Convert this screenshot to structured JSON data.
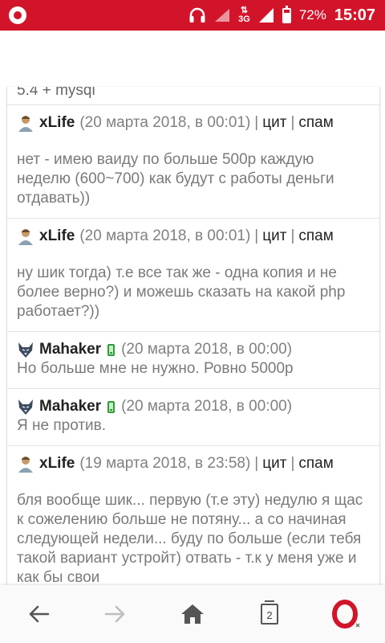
{
  "status_bar": {
    "network": "3G",
    "battery_percent": "72%",
    "battery_level": 0.72,
    "time": "15:07"
  },
  "truncated_line": "5.4 + mysql",
  "posts": [
    {
      "author": "xLife",
      "date": "(20 марта 2018, в 00:01)",
      "cite": "цит",
      "spam": "спам",
      "text": "нет - имею ваиду по больше 500р каждую неделю (600~700) как будут с работы деньги отдавать))"
    },
    {
      "author": "xLife",
      "date": "(20 марта 2018, в 00:01)",
      "cite": "цит",
      "spam": "спам",
      "text": "ну шик тогда) т.е все так же - одна копия и не более верно?) и можешь сказать на какой php работает?))"
    },
    {
      "author": "Mahaker",
      "date": "(20 марта 2018, в 00:00)",
      "text": "Но больше мне не нужно. Ровно 5000р"
    },
    {
      "author": "Mahaker",
      "date": "(20 марта 2018, в 00:00)",
      "text": "Я не против."
    },
    {
      "author": "xLife",
      "date": "(19 марта 2018, в 23:58)",
      "cite": "цит",
      "spam": "спам",
      "text": "бля вообще шик... первую (т.е эту) недулю я щас к сожелению больше не потяну... а со начиная следующей недели... буду по больше (если тебя такой вариант устройт) отвать - т.к у меня уже и как бы свои"
    }
  ],
  "nav": {
    "tab_count": "2"
  },
  "colors": {
    "status_bar": "#d2142a",
    "opera_red": "#d2142a",
    "mobile_badge": "#2e9a3b"
  },
  "icons": {
    "back": "arrow-left-icon",
    "forward": "arrow-right-icon",
    "home": "home-icon",
    "tabs": "tabs-icon",
    "opera": "opera-logo-icon"
  }
}
